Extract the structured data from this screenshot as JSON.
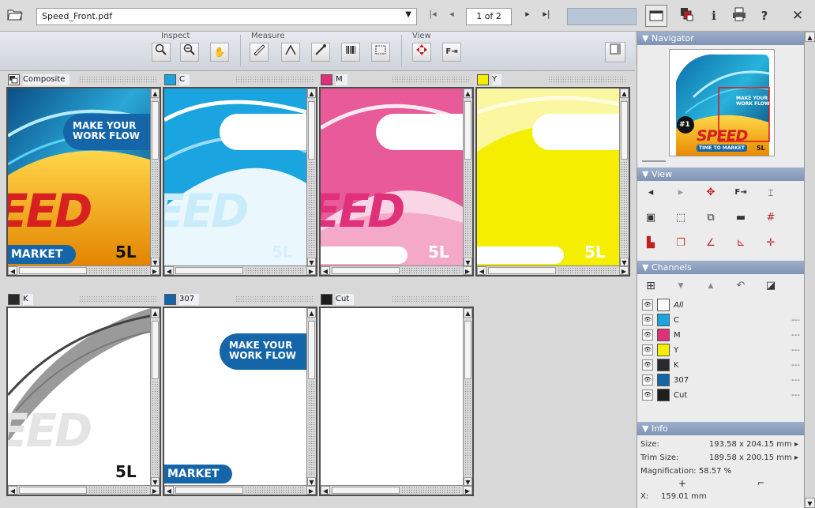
{
  "toolbar": {
    "file_name": "Speed_Front.pdf",
    "page_indicator": "1 of 2",
    "nav": [
      "|◂",
      "◂",
      "▸",
      "▸|"
    ],
    "right_icons": [
      "view-icon",
      "separations-icon",
      "info-icon",
      "print-icon",
      "help-icon",
      "close-icon"
    ],
    "info_glyph": "i",
    "help_glyph": "?",
    "close_glyph": "✕"
  },
  "tools": {
    "inspect_label": "Inspect",
    "measure_label": "Measure",
    "view_label": "View",
    "icons": [
      "zoom-in-icon",
      "zoom-out-icon",
      "hand-icon",
      "ruler-icon",
      "angle-icon",
      "densitometer-icon",
      "barcode-icon",
      "area-icon",
      "navigate-icon",
      "fit-page-icon"
    ]
  },
  "panes": [
    {
      "name": "Composite",
      "swatch": "composite",
      "color": "#f0f0f0",
      "variant": "composite"
    },
    {
      "name": "C",
      "swatch": "#1aa4e0",
      "variant": "cyan"
    },
    {
      "name": "M",
      "swatch": "#e0307a",
      "variant": "magenta"
    },
    {
      "name": "Y",
      "swatch": "#f5ee00",
      "variant": "yellow"
    },
    {
      "name": "K",
      "swatch": "#2a2a2a",
      "variant": "black"
    },
    {
      "name": "307",
      "swatch": "#1566a8",
      "variant": "spot"
    },
    {
      "name": "Cut",
      "swatch": "#1e1e1e",
      "variant": "cut"
    }
  ],
  "artwork": {
    "headline1": "MAKE YOUR",
    "headline2": "WORK FLOW",
    "speed": "EED",
    "market": "MARKET",
    "size_mark": "5L",
    "nav_headline1": "MAKE YOUR",
    "nav_headline2": "WORK FLOW",
    "nav_speed": "SPEED",
    "nav_badge": "#1",
    "nav_tagline": "TIME TO MARKET",
    "nav_size": "5L"
  },
  "right_panel": {
    "navigator_title": "Navigator",
    "view_title": "View",
    "channels_title": "Channels",
    "info_title": "Info",
    "channels": [
      {
        "name": "All",
        "color": "#ffffff",
        "value": ""
      },
      {
        "name": "C",
        "color": "#1aa4e0",
        "value": "---"
      },
      {
        "name": "M",
        "color": "#e0307a",
        "value": "---"
      },
      {
        "name": "Y",
        "color": "#f5ee00",
        "value": "---"
      },
      {
        "name": "K",
        "color": "#2a2a2a",
        "value": "---"
      },
      {
        "name": "307",
        "color": "#1566a8",
        "value": "---"
      },
      {
        "name": "Cut",
        "color": "#1e1e1e",
        "value": "---"
      }
    ],
    "info": {
      "size_label": "Size:",
      "size_value": "193.58 x 204.15 mm ▸",
      "trim_label": "Trim Size:",
      "trim_value": "189.58 x 200.15 mm ▸",
      "magnification": "Magnification: 58.57 %",
      "x_label": "X:",
      "x_value": "159.01 mm"
    }
  }
}
